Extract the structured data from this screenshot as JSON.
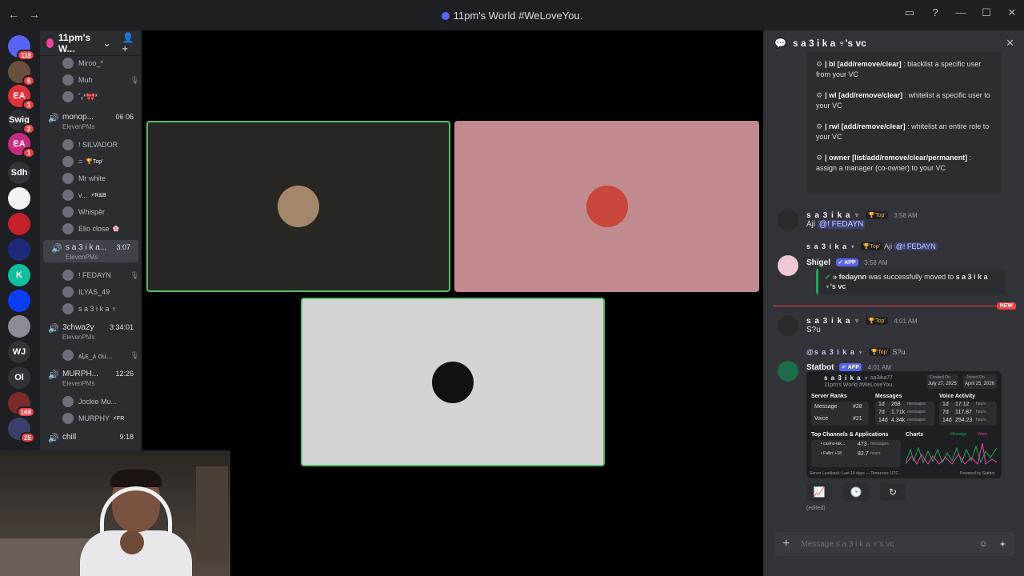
{
  "window": {
    "title": "11pm's World #WeLoveYou.",
    "nav_back": "←",
    "nav_forward": "→",
    "controls": [
      "▭",
      "?",
      "—",
      "☐",
      "✕"
    ]
  },
  "rail": {
    "servers": [
      {
        "label": "",
        "badge": "118",
        "color": "#5865f2"
      },
      {
        "label": "",
        "badge": "6",
        "color": "#6b4e3d"
      },
      {
        "label": "EA",
        "badge": "1",
        "color": "#e0303c"
      },
      {
        "label": "Swig",
        "badge": "2",
        "color": "#2b2d31"
      },
      {
        "label": "EA",
        "badge": "1",
        "color": "#c62a7f"
      },
      {
        "label": "Sdh",
        "badge": "",
        "color": "#313338"
      },
      {
        "label": "",
        "badge": "",
        "color": "#f2f3f5"
      },
      {
        "label": "",
        "badge": "",
        "color": "#c4202a"
      },
      {
        "label": "",
        "badge": "",
        "color": "#1d2a7a"
      },
      {
        "label": "K",
        "badge": "",
        "color": "#0fbf9f"
      },
      {
        "label": "",
        "badge": "",
        "color": "#0b3df2"
      },
      {
        "label": "",
        "badge": "",
        "color": "#8a8d93"
      },
      {
        "label": "WJ",
        "badge": "",
        "color": "#313338"
      },
      {
        "label": "Ol",
        "badge": "",
        "color": "#313338"
      },
      {
        "label": "",
        "badge": "168",
        "color": "#7a2b2b"
      },
      {
        "label": "",
        "badge": "25",
        "color": "#3d3f6b"
      }
    ]
  },
  "sidebar": {
    "server_name": "11pm's W...",
    "chevron": "⌄",
    "invite_icon": "👤+",
    "top_members": [
      {
        "name": "Miroo_*",
        "mute": ""
      },
      {
        "name": "Muh",
        "mute": "🎙"
      },
      {
        "name": "˚ₓ*🎀*",
        "mute": ""
      }
    ],
    "channels": [
      {
        "name": "monop...",
        "sub": "ElevenPMs",
        "time": "06 06",
        "active": false,
        "members": [
          {
            "name": "! SILVADOR",
            "tag": "",
            "mute": ""
          },
          {
            "name": "=",
            "tag": "🏆Top'",
            "mute": ""
          },
          {
            "name": "Mr white",
            "tag": "",
            "mute": ""
          },
          {
            "name": "v...",
            "tag": "⚡R&B",
            "mute": ""
          },
          {
            "name": "Whispêr",
            "tag": "",
            "mute": ""
          },
          {
            "name": "Elio close",
            "tag": "🌸",
            "mute": ""
          }
        ]
      },
      {
        "name": "s a 3 i k a...",
        "sub": "ElevenPMs",
        "time": "3:07",
        "active": true,
        "members": [
          {
            "name": "! FEDAYN",
            "tag": "",
            "mute": "🎙"
          },
          {
            "name": "ILYAS_49",
            "tag": "",
            "mute": ""
          },
          {
            "name": "s a 3 i k a ♆",
            "tag": "",
            "mute": ""
          }
        ]
      },
      {
        "name": "3chwa2y",
        "sub": "ElevenPMs",
        "time": "3:34:01",
        "active": false,
        "members": [
          {
            "name": "ᴀꝲᴇ_ᴀ ou...",
            "tag": "",
            "mute": "🎙"
          }
        ]
      },
      {
        "name": "MURPH...",
        "sub": "ElevenPMs",
        "time": "12:26",
        "active": false,
        "members": [
          {
            "name": "Jockie Mu...",
            "tag": "",
            "mute": ""
          },
          {
            "name": "MURPHY",
            "tag": "⚡FR",
            "mute": ""
          }
        ]
      },
      {
        "name": "chill",
        "sub": "",
        "time": "9:18",
        "active": false,
        "members": []
      }
    ]
  },
  "stage": {
    "tiles": [
      {
        "bg": "#272623",
        "border": "#4fbf6a",
        "avatar": "#a4876a"
      },
      {
        "bg": "#c08a8e",
        "border": "#c08a8e",
        "avatar": "#c8463a"
      },
      {
        "bg": "#d4d4d4",
        "border": "#4fbf6a",
        "avatar": "#111111"
      }
    ]
  },
  "chat": {
    "header_title": "s a 3 i k a ♆'s vc",
    "commands": [
      {
        "cmd": "| bl [add/remove/clear]",
        "desc": ": blacklist a specific user from your VC"
      },
      {
        "cmd": "| wl [add/remove/clear]",
        "desc": ": whitelist a specific user to your VC"
      },
      {
        "cmd": "| rwl [add/remove/clear]",
        "desc": ": whitelist an entire role to your VC"
      },
      {
        "cmd": "| owner [list/add/remove/clear/permanent]",
        "desc": ": assign a manager (co-owner) to your VC"
      }
    ],
    "messages": {
      "m1": {
        "author": "s a 3 i k a ♆",
        "badge": "🏆Top'",
        "time": "3:58 AM",
        "text": "Aji",
        "mention": "@! FEDAYN"
      },
      "m2": {
        "reply_author": "s a 3 i k a ♆",
        "reply_badge": "🏆Top'",
        "reply_text": "Aji",
        "reply_mention": "@! FEDAYN",
        "author": "Shigel",
        "app": "✔ APP",
        "time": "3:58 AM",
        "embed_user": "» fedaynn",
        "embed_mid": "was successfully moved to",
        "embed_target": "s a 3 i k a ♆'s vc"
      },
      "new_label": "NEW",
      "m3": {
        "author": "s a 3 i k a ♆",
        "badge": "🏆Top'",
        "time": "4:01 AM",
        "text": "S?u"
      },
      "m4": {
        "reply_author": "@s a 3 i k a ♆",
        "reply_badge": "🏆Top'",
        "reply_text": "S?u",
        "author": "Statbot",
        "app": "✔ APP",
        "time": "4:01 AM",
        "edited": "(edited)"
      }
    },
    "stat_card": {
      "name": "s a 3 i k a ♆",
      "handle": "sa3ika77",
      "server": "11pm's World #WeLoveYou.",
      "created_label": "Created On",
      "created": "July 27, 2025",
      "joined_label": "Joined On",
      "joined": "April 25, 2026",
      "ranks_title": "Server Ranks",
      "ranks": [
        {
          "k": "Message",
          "v": "#28"
        },
        {
          "k": "Voice",
          "v": "#21"
        }
      ],
      "messages_title": "Messages",
      "messages": [
        {
          "p": "1d",
          "v": "268",
          "u": "messages"
        },
        {
          "p": "7d",
          "v": "1.71k",
          "u": "messages"
        },
        {
          "p": "14d",
          "v": "4.34k",
          "u": "messages"
        }
      ],
      "voice_title": "Voice Activity",
      "voice": [
        {
          "p": "1d",
          "v": "17.12",
          "u": "hours"
        },
        {
          "p": "7d",
          "v": "117.87",
          "u": "hours"
        },
        {
          "p": "14d",
          "v": "254.23",
          "u": "hours"
        }
      ],
      "channels_title": "Top Channels & Applications",
      "channels": [
        {
          "name": "• casino-tak...",
          "v": "473",
          "u": "messages"
        },
        {
          "name": "• Fallin' +18",
          "v": "82.7",
          "u": "hours"
        }
      ],
      "charts_title": "Charts",
      "legend_message": "Message",
      "legend_voice": "Voice",
      "footer_left": "Server Lookback: Last 14 days — Timezone: UTC",
      "footer_right": "Powered by Statbot"
    },
    "actions": [
      "📈",
      "🕒",
      "↻"
    ],
    "input_placeholder": "Message s a 3 i k a ♆'s vc",
    "input_plus": "+",
    "input_icons": [
      "☺",
      "✦"
    ]
  }
}
